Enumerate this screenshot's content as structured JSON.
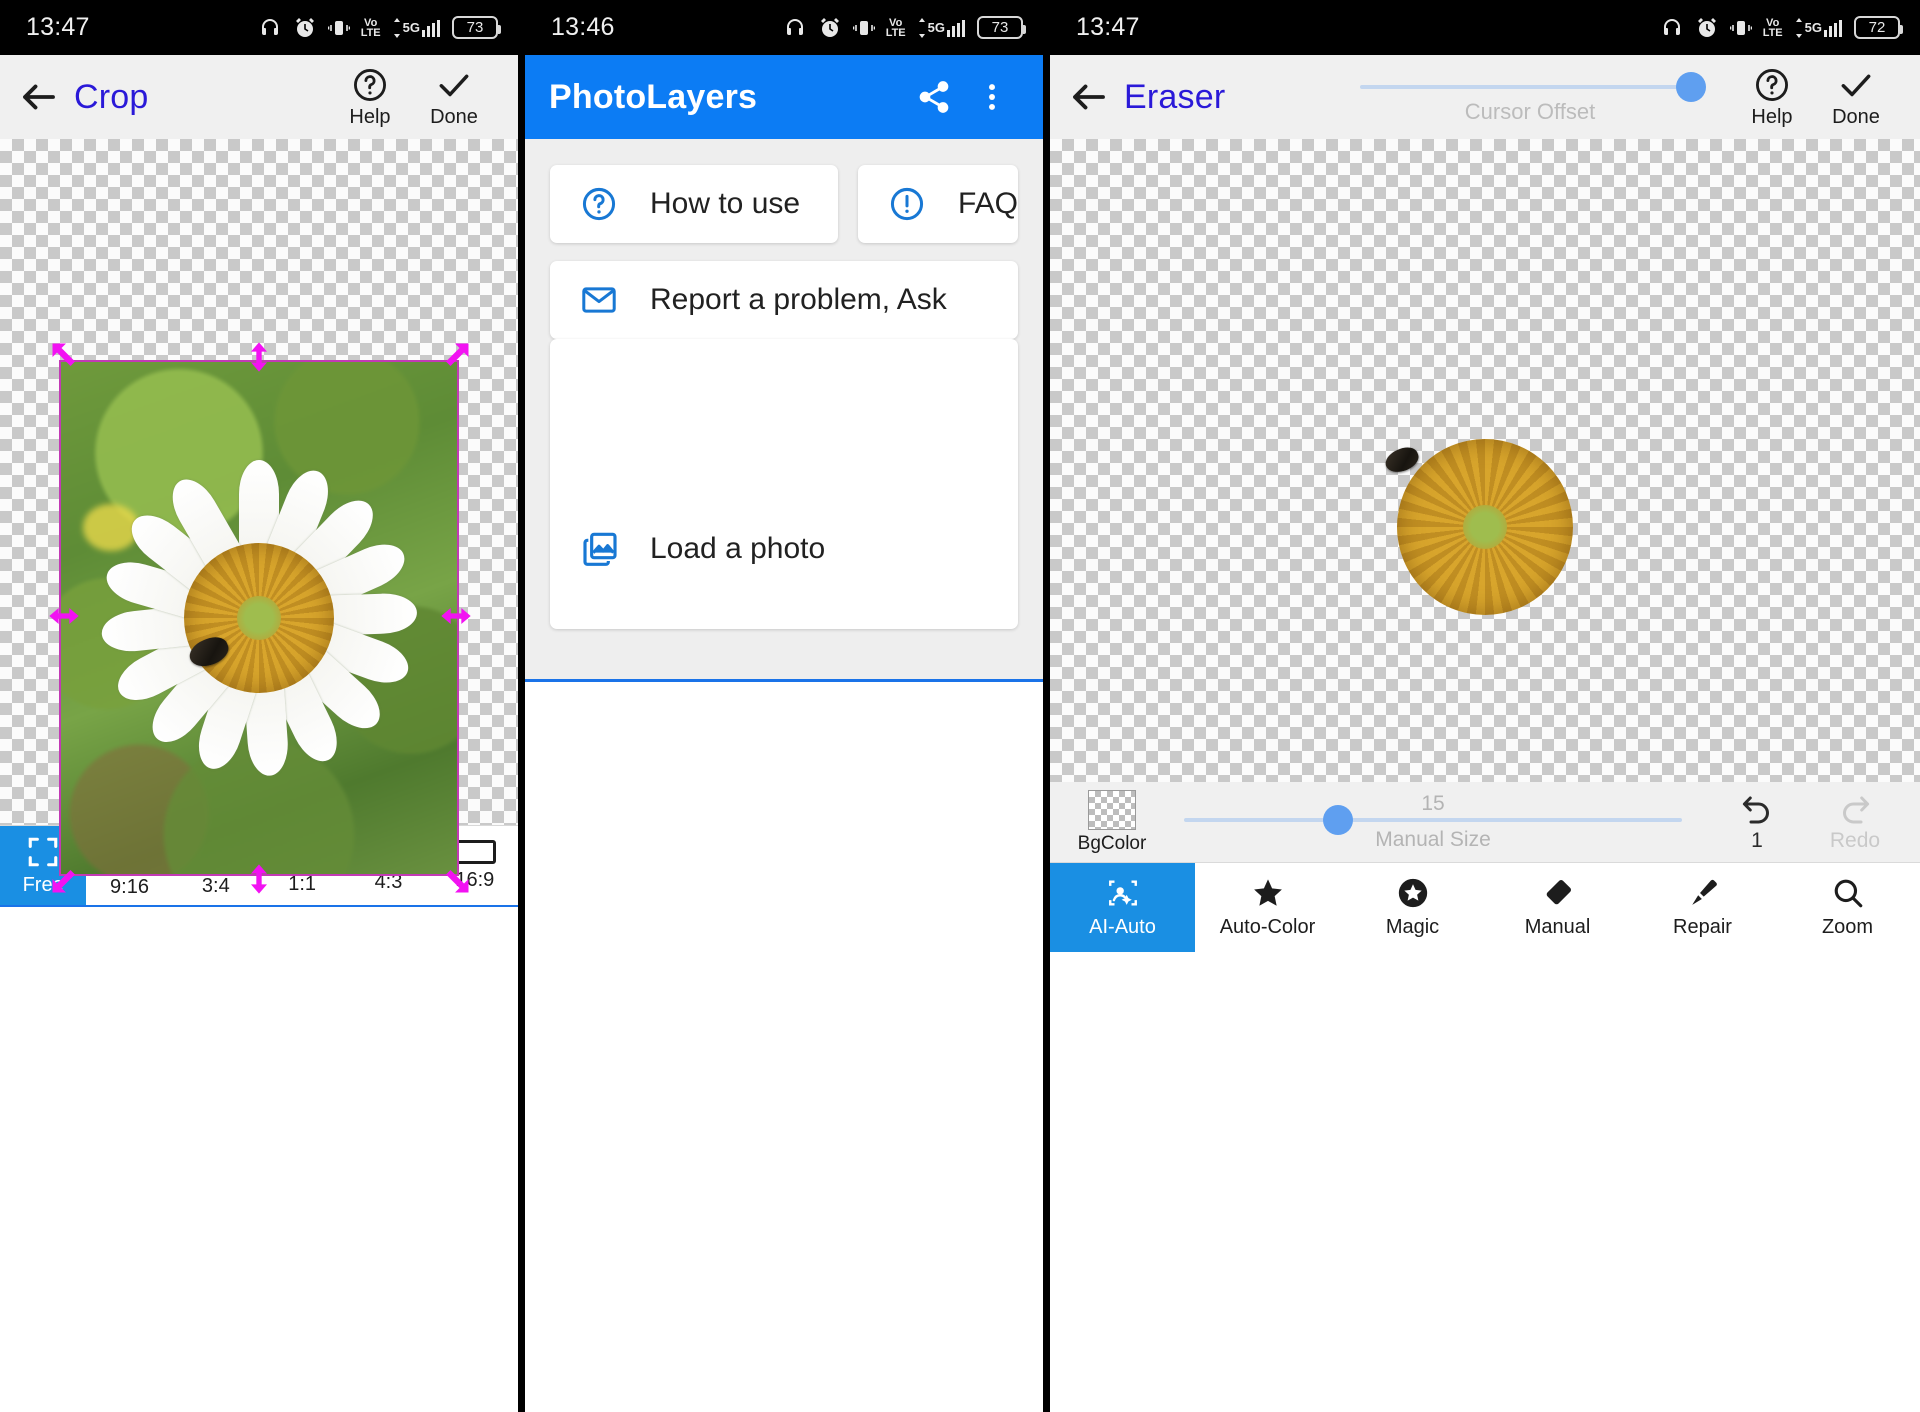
{
  "panels": {
    "crop": {
      "status": {
        "time": "13:47",
        "battery": "73",
        "network": "5G",
        "volte": "VoLTE",
        "icons": [
          "headphones-icon",
          "alarm-icon",
          "vibrate-icon",
          "volte-icon",
          "signal-icon",
          "battery-icon"
        ]
      },
      "appbar": {
        "back": "back-arrow-icon",
        "title": "Crop",
        "help_label": "Help",
        "help_icon": "help-circle-icon",
        "done_label": "Done",
        "done_icon": "check-icon"
      },
      "ratios": [
        {
          "label": "Free",
          "icon": "free-crop-icon",
          "active": true
        },
        {
          "label": "9:16",
          "icon": "portrait-tall-icon",
          "active": false
        },
        {
          "label": "3:4",
          "icon": "portrait-icon",
          "active": false
        },
        {
          "label": "1:1",
          "icon": "square-icon",
          "active": false
        },
        {
          "label": "4:3",
          "icon": "landscape-icon",
          "active": false
        },
        {
          "label": "16:9",
          "icon": "landscape-wide-icon",
          "active": false
        }
      ],
      "selection_color": "#f212f2",
      "frame_color": "#c23ab5"
    },
    "home": {
      "status": {
        "time": "13:46",
        "battery": "73"
      },
      "appbar": {
        "title": "PhotoLayers",
        "share_icon": "share-icon",
        "overflow_icon": "more-vert-icon",
        "color": "#0c7cf4"
      },
      "cards": [
        {
          "id": "howto",
          "label": "How to use",
          "icon": "help-circle-icon"
        },
        {
          "id": "faq",
          "label": "FAQ",
          "icon": "info-circle-icon"
        },
        {
          "id": "report",
          "label": "Report a problem, Ask",
          "icon": "mail-icon"
        },
        {
          "id": "load",
          "label": "Load a photo",
          "icon": "photo-library-icon"
        }
      ]
    },
    "eraser": {
      "status": {
        "time": "13:47",
        "battery": "72"
      },
      "appbar": {
        "back": "back-arrow-icon",
        "title": "Eraser",
        "slider_label": "Cursor Offset",
        "help_label": "Help",
        "help_icon": "help-circle-icon",
        "done_label": "Done",
        "done_icon": "check-icon"
      },
      "toolbar": {
        "bgcolor_label": "BgColor",
        "size_value": "15",
        "size_label": "Manual Size",
        "undo_label": "1",
        "undo_icon": "undo-icon",
        "redo_label": "Redo",
        "redo_icon": "redo-icon"
      },
      "tabs": [
        {
          "label": "AI-Auto",
          "icon": "ai-auto-icon",
          "active": true
        },
        {
          "label": "Auto-Color",
          "icon": "star-icon",
          "active": false
        },
        {
          "label": "Magic",
          "icon": "star-circle-icon",
          "active": false
        },
        {
          "label": "Manual",
          "icon": "eraser-icon",
          "active": false
        },
        {
          "label": "Repair",
          "icon": "brush-icon",
          "active": false
        },
        {
          "label": "Zoom",
          "icon": "search-icon",
          "active": false
        }
      ]
    }
  }
}
